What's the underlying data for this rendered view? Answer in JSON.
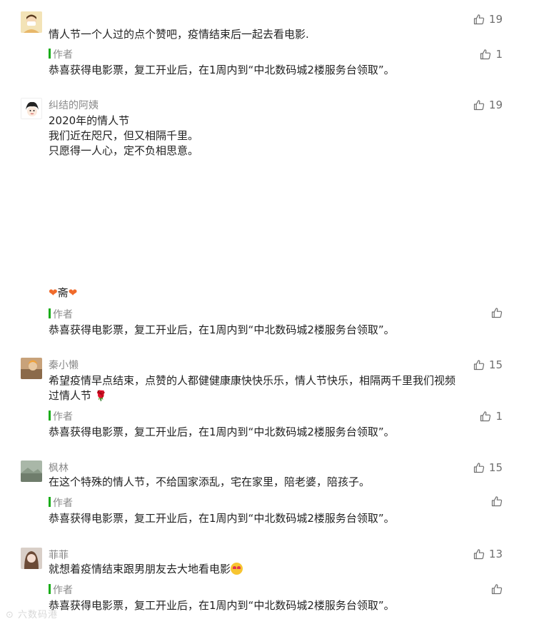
{
  "reply_author_label": "作者",
  "reply_text": "恭喜获得电影票，复工开业后，在1周内到“中北数码城2楼服务台领取”。",
  "watermark": "六数码港",
  "comments": [
    {
      "nickname": "",
      "text_lines": [
        "情人节一个人过的点个赞吧，疫情结束后一起去看电影."
      ],
      "likes": "19",
      "reply_likes": "1",
      "avatar_icon": "masked-person-avatar"
    },
    {
      "nickname": "纠结的阿姨",
      "text_lines": [
        "2020年的情人节",
        "我们近在咫尺，但又相隔千里。",
        "只愿得一人心，定不负相思意。"
      ],
      "trailing_line": "斋",
      "likes": "19",
      "reply_likes": "",
      "avatar_icon": "cartoon-girl-avatar"
    },
    {
      "nickname": "秦小懒",
      "text_lines": [
        "希望疫情早点结束，点赞的人都健健康康快快乐乐，情人节快乐，相隔两千里我们视频",
        "过情人节"
      ],
      "likes": "15",
      "reply_likes": "1",
      "avatar_icon": "photo-avatar"
    },
    {
      "nickname": "枫林",
      "text_lines": [
        "在这个特殊的情人节，不给国家添乱，宅在家里，陪老婆，陪孩子。"
      ],
      "likes": "15",
      "reply_likes": "",
      "avatar_icon": "landscape-avatar"
    },
    {
      "nickname": "菲菲",
      "text_lines": [
        "就想着疫情结束跟男朋友去大地看电影"
      ],
      "likes": "13",
      "reply_likes": "",
      "avatar_icon": "portrait-avatar"
    }
  ]
}
